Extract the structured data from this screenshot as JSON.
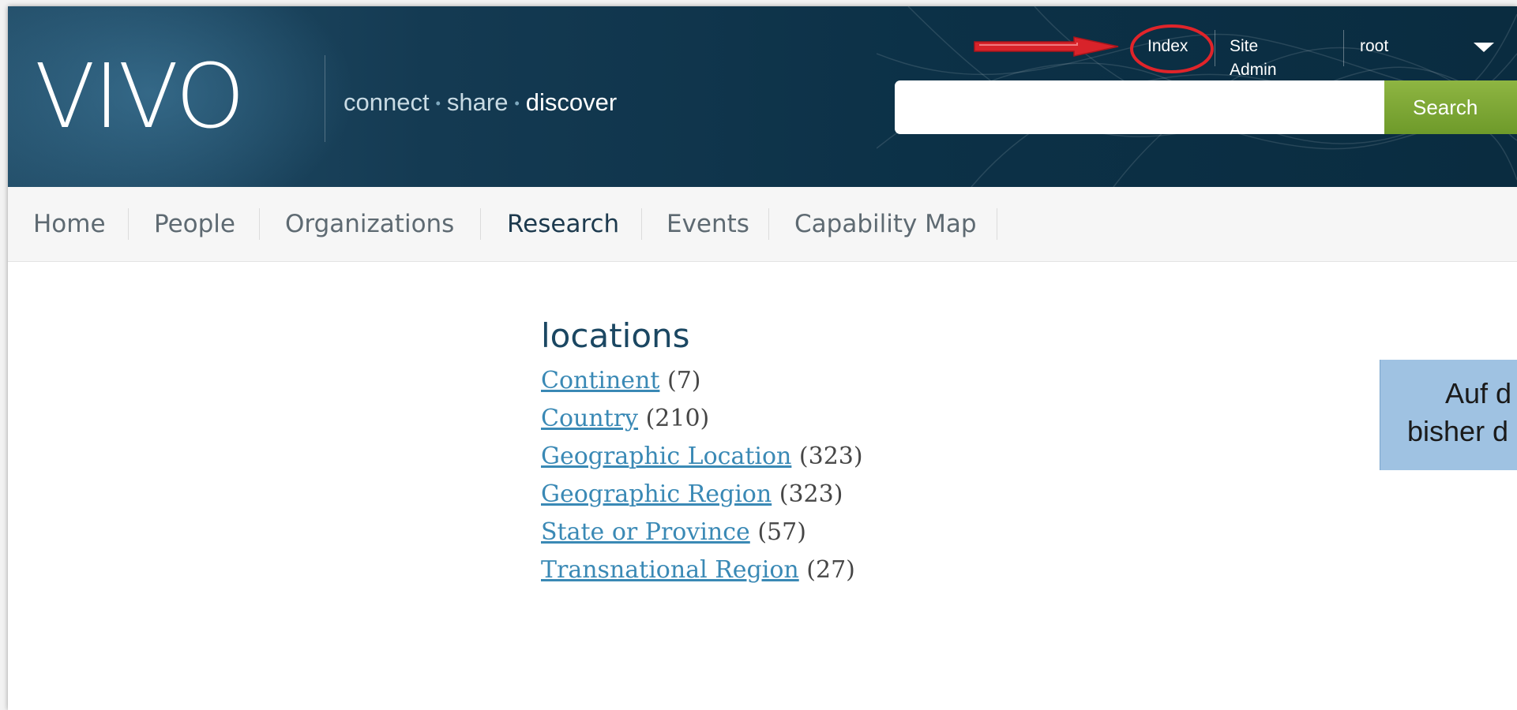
{
  "header": {
    "logo_text": "VIVO",
    "tagline": {
      "connect": "connect",
      "share": "share",
      "discover": "discover",
      "separator": "•"
    },
    "top_links": {
      "index": "Index",
      "site_admin": "Site Admin",
      "user": "root"
    },
    "search": {
      "value": "",
      "placeholder": "",
      "button_label": "Search"
    },
    "colors": {
      "header_bg": "#0c3147",
      "search_button": "#7ea83a",
      "annotation_red": "#e0242a"
    }
  },
  "nav": {
    "items": [
      {
        "label": "Home",
        "active": false
      },
      {
        "label": "People",
        "active": false
      },
      {
        "label": "Organizations",
        "active": false
      },
      {
        "label": "Research",
        "active": true
      },
      {
        "label": "Events",
        "active": false
      },
      {
        "label": "Capability Map",
        "active": false
      }
    ]
  },
  "main": {
    "title": "locations",
    "classes": [
      {
        "label": "Continent",
        "count": "(7)"
      },
      {
        "label": "Country",
        "count": "(210)"
      },
      {
        "label": "Geographic Location",
        "count": "(323)"
      },
      {
        "label": "Geographic Region",
        "count": "(323)"
      },
      {
        "label": "State or Province",
        "count": "(57)"
      },
      {
        "label": "Transnational Region",
        "count": "(27)"
      }
    ]
  },
  "callout": {
    "line1": "Auf d",
    "line2": "bisher d"
  },
  "icons": {
    "dropdown": "chevron-down-icon",
    "arrow": "arrow-right-icon",
    "circle": "highlight-circle"
  }
}
